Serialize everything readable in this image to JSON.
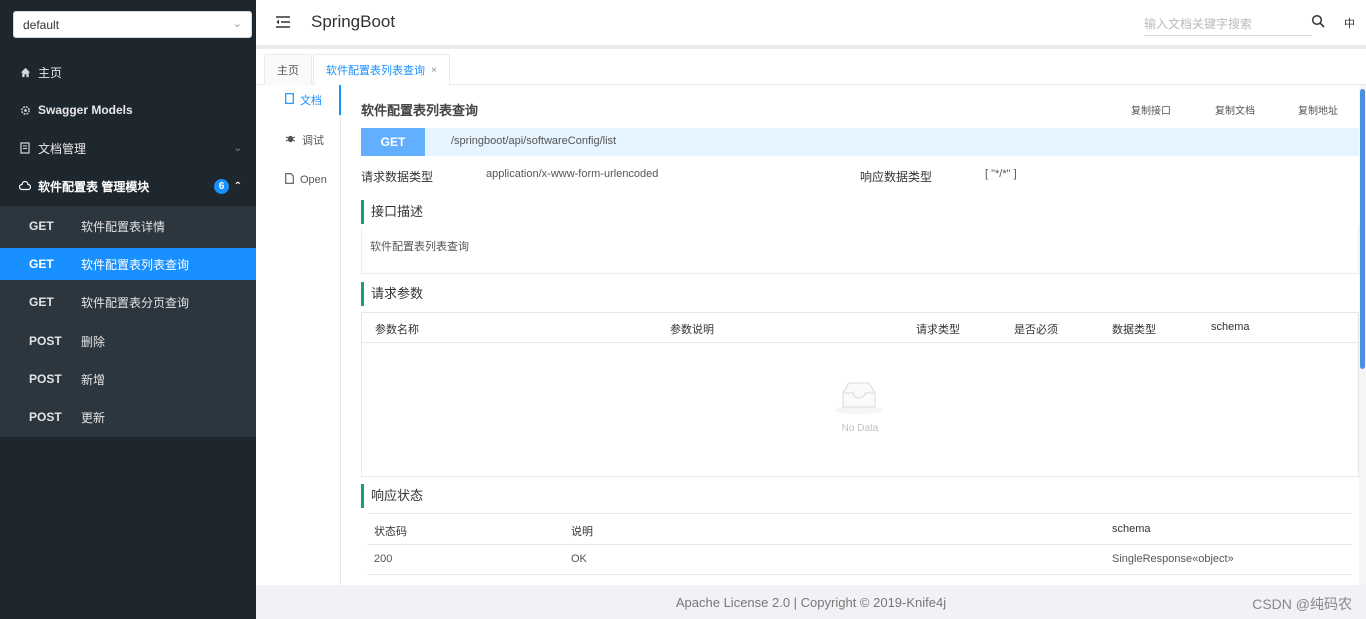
{
  "sidebar": {
    "group_select": "default",
    "items": [
      {
        "label": "主页",
        "icon": "home-icon"
      },
      {
        "label": "Swagger Models",
        "icon": "gear-icon"
      },
      {
        "label": "文档管理",
        "icon": "document-icon"
      },
      {
        "label": "软件配置表 管理模块",
        "icon": "cloud-icon",
        "badge": "6"
      }
    ],
    "sub_items": [
      {
        "method": "GET",
        "title": "软件配置表详情"
      },
      {
        "method": "GET",
        "title": "软件配置表列表查询"
      },
      {
        "method": "GET",
        "title": "软件配置表分页查询"
      },
      {
        "method": "POST",
        "title": "删除"
      },
      {
        "method": "POST",
        "title": "新增"
      },
      {
        "method": "POST",
        "title": "更新"
      }
    ]
  },
  "header": {
    "title": "SpringBoot",
    "search_placeholder": "输入文档关键字搜索",
    "lang": "中"
  },
  "tabs": [
    {
      "label": "主页"
    },
    {
      "label": "软件配置表列表查询",
      "close": "×"
    }
  ],
  "vtabs": [
    {
      "label": "文档",
      "icon": "document-icon"
    },
    {
      "label": "调试",
      "icon": "bug-icon"
    },
    {
      "label": "Open",
      "icon": "file-icon"
    }
  ],
  "api": {
    "title": "软件配置表列表查询",
    "copy_api": "复制接口",
    "copy_doc": "复制文档",
    "copy_url": "复制地址",
    "method": "GET",
    "path": "/springboot/api/softwareConfig/list",
    "request_type_label": "请求数据类型",
    "request_type": "application/x-www-form-urlencoded",
    "response_type_label": "响应数据类型",
    "response_type": "[ \"*/*\" ]"
  },
  "description": {
    "heading": "接口描述",
    "text": "软件配置表列表查询"
  },
  "params": {
    "heading": "请求参数",
    "columns": [
      "参数名称",
      "参数说明",
      "请求类型",
      "是否必须",
      "数据类型",
      "schema"
    ],
    "empty_text": "No Data"
  },
  "responses": {
    "heading": "响应状态",
    "columns": [
      "状态码",
      "说明",
      "schema"
    ],
    "rows": [
      {
        "code": "200",
        "desc": "OK",
        "schema": "SingleResponse«object»"
      }
    ]
  },
  "footer": {
    "text": "Apache License 2.0 | Copyright © 2019-Knife4j",
    "watermark": "CSDN @纯码农"
  }
}
